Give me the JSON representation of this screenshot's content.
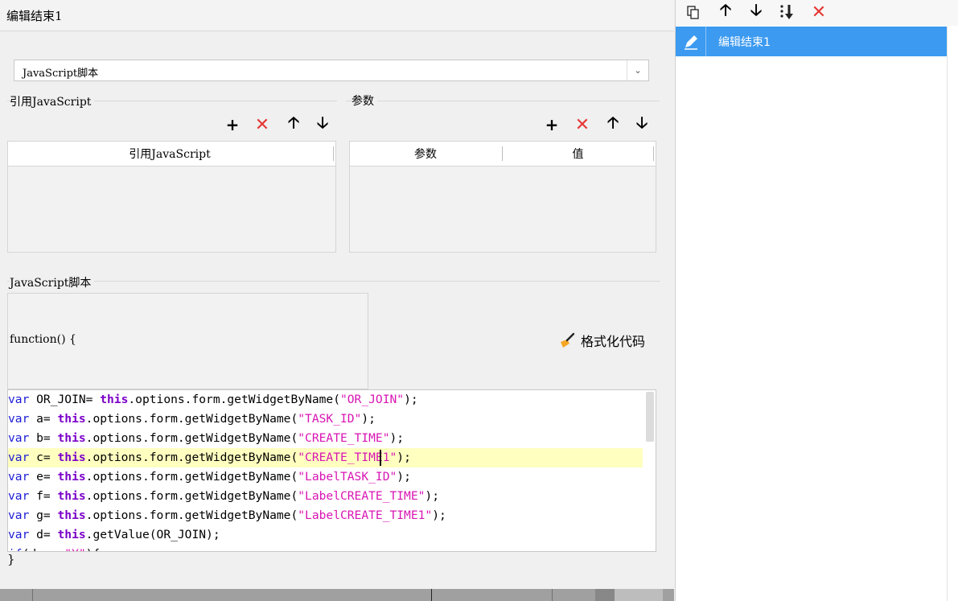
{
  "title": "编辑结束1",
  "type_select": {
    "value": "JavaScript脚本"
  },
  "ref_section": {
    "label": "引用JavaScript",
    "column": "引用JavaScript"
  },
  "param_section": {
    "label": "参数",
    "columns": [
      "参数",
      "值"
    ]
  },
  "script_section": {
    "label": "JavaScript脚本",
    "function_header": "function() {",
    "closing": "}"
  },
  "format_button": {
    "label": "格式化代码"
  },
  "code_lines": [
    [
      [
        "kw",
        "var"
      ],
      [
        "t",
        " OR_JOIN= "
      ],
      [
        "kw2",
        "this"
      ],
      [
        "t",
        ".options.form.getWidgetByName("
      ],
      [
        "str",
        "\"OR_JOIN\""
      ],
      [
        "t",
        ");"
      ]
    ],
    [
      [
        "kw",
        "var"
      ],
      [
        "t",
        " a= "
      ],
      [
        "kw2",
        "this"
      ],
      [
        "t",
        ".options.form.getWidgetByName("
      ],
      [
        "str",
        "\"TASK_ID\""
      ],
      [
        "t",
        ");"
      ]
    ],
    [
      [
        "kw",
        "var"
      ],
      [
        "t",
        " b= "
      ],
      [
        "kw2",
        "this"
      ],
      [
        "t",
        ".options.form.getWidgetByName("
      ],
      [
        "str",
        "\"CREATE_TIME\""
      ],
      [
        "t",
        ");"
      ]
    ],
    [
      [
        "kw",
        "var"
      ],
      [
        "t",
        " c= "
      ],
      [
        "kw2",
        "this"
      ],
      [
        "t",
        ".options.form.getWidgetByName("
      ],
      [
        "str",
        "\"CREATE_TIME1\""
      ],
      [
        "t",
        ");"
      ]
    ],
    [
      [
        "kw",
        "var"
      ],
      [
        "t",
        " e= "
      ],
      [
        "kw2",
        "this"
      ],
      [
        "t",
        ".options.form.getWidgetByName("
      ],
      [
        "str",
        "\"LabelTASK_ID\""
      ],
      [
        "t",
        ");"
      ]
    ],
    [
      [
        "kw",
        "var"
      ],
      [
        "t",
        " f= "
      ],
      [
        "kw2",
        "this"
      ],
      [
        "t",
        ".options.form.getWidgetByName("
      ],
      [
        "str",
        "\"LabelCREATE_TIME\""
      ],
      [
        "t",
        ");"
      ]
    ],
    [
      [
        "kw",
        "var"
      ],
      [
        "t",
        " g= "
      ],
      [
        "kw2",
        "this"
      ],
      [
        "t",
        ".options.form.getWidgetByName("
      ],
      [
        "str",
        "\"LabelCREATE_TIME1\""
      ],
      [
        "t",
        ");"
      ]
    ],
    [
      [
        "kw",
        "var"
      ],
      [
        "t",
        " d= "
      ],
      [
        "kw2",
        "this"
      ],
      [
        "t",
        ".getValue(OR_JOIN);"
      ]
    ],
    [
      [
        "kw",
        "if"
      ],
      [
        "t",
        "(d == "
      ],
      [
        "str",
        "\"Y\""
      ],
      [
        "t",
        "){"
      ]
    ]
  ],
  "right_panel": {
    "items": [
      {
        "label": "编辑结束1",
        "icon": "pencil-icon"
      }
    ]
  },
  "colors": {
    "selection": "#3c9af0",
    "keyword": "#1b1bd6",
    "this_keyword": "#7a00c8",
    "string": "#d815b3",
    "delete": "#e53935",
    "highlight_line": "#ffffc0"
  }
}
